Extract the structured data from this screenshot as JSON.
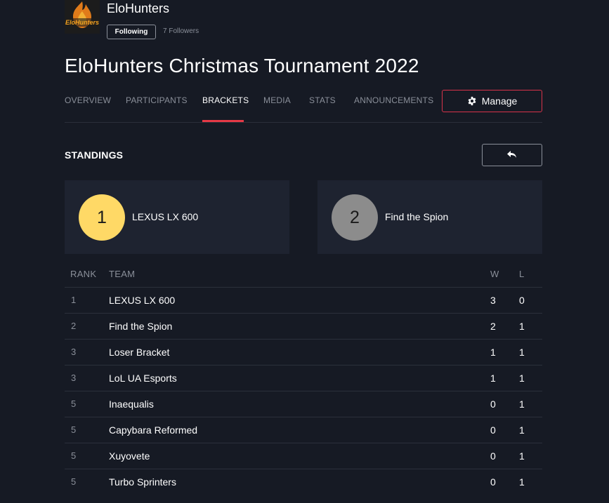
{
  "org": {
    "name": "EloHunters",
    "follow_label": "Following",
    "followers_text": "7 Followers",
    "logo_text": "EloHunters",
    "logo_colors": {
      "fire": "#e07b1a",
      "dark": "#1c1c1c"
    }
  },
  "title": "EloHunters Christmas Tournament 2022",
  "tabs": [
    {
      "label": "OVERVIEW"
    },
    {
      "label": "PARTICIPANTS"
    },
    {
      "label": "BRACKETS",
      "active": true
    },
    {
      "label": "MEDIA"
    },
    {
      "label": "STATS"
    },
    {
      "label": "ANNOUNCEMENTS"
    }
  ],
  "manage": {
    "label": "Manage",
    "icon": "gear-icon",
    "border_color": "#d8334a"
  },
  "standings": {
    "title": "STANDINGS",
    "back_icon": "reply-arrow-icon"
  },
  "podium": [
    {
      "place": "1",
      "team": "LEXUS LX 600",
      "color": "#ffd966"
    },
    {
      "place": "2",
      "team": "Find the Spion",
      "color": "#8c8c8c"
    }
  ],
  "table": {
    "headers": {
      "rank": "RANK",
      "team": "TEAM",
      "w": "W",
      "l": "L"
    },
    "rows": [
      {
        "rank": "1",
        "team": "LEXUS LX 600",
        "w": "3",
        "l": "0"
      },
      {
        "rank": "2",
        "team": "Find the Spion",
        "w": "2",
        "l": "1"
      },
      {
        "rank": "3",
        "team": "Loser Bracket",
        "w": "1",
        "l": "1"
      },
      {
        "rank": "3",
        "team": "LoL UA Esports",
        "w": "1",
        "l": "1"
      },
      {
        "rank": "5",
        "team": "Inaequalis",
        "w": "0",
        "l": "1"
      },
      {
        "rank": "5",
        "team": "Capybara Reformed",
        "w": "0",
        "l": "1"
      },
      {
        "rank": "5",
        "team": "Xuyovete",
        "w": "0",
        "l": "1"
      },
      {
        "rank": "5",
        "team": "Turbo Sprinters",
        "w": "0",
        "l": "1"
      }
    ]
  },
  "colors": {
    "background": "#161a24",
    "card": "#1e2330",
    "accent": "#e63946",
    "muted": "#8a8f99"
  }
}
